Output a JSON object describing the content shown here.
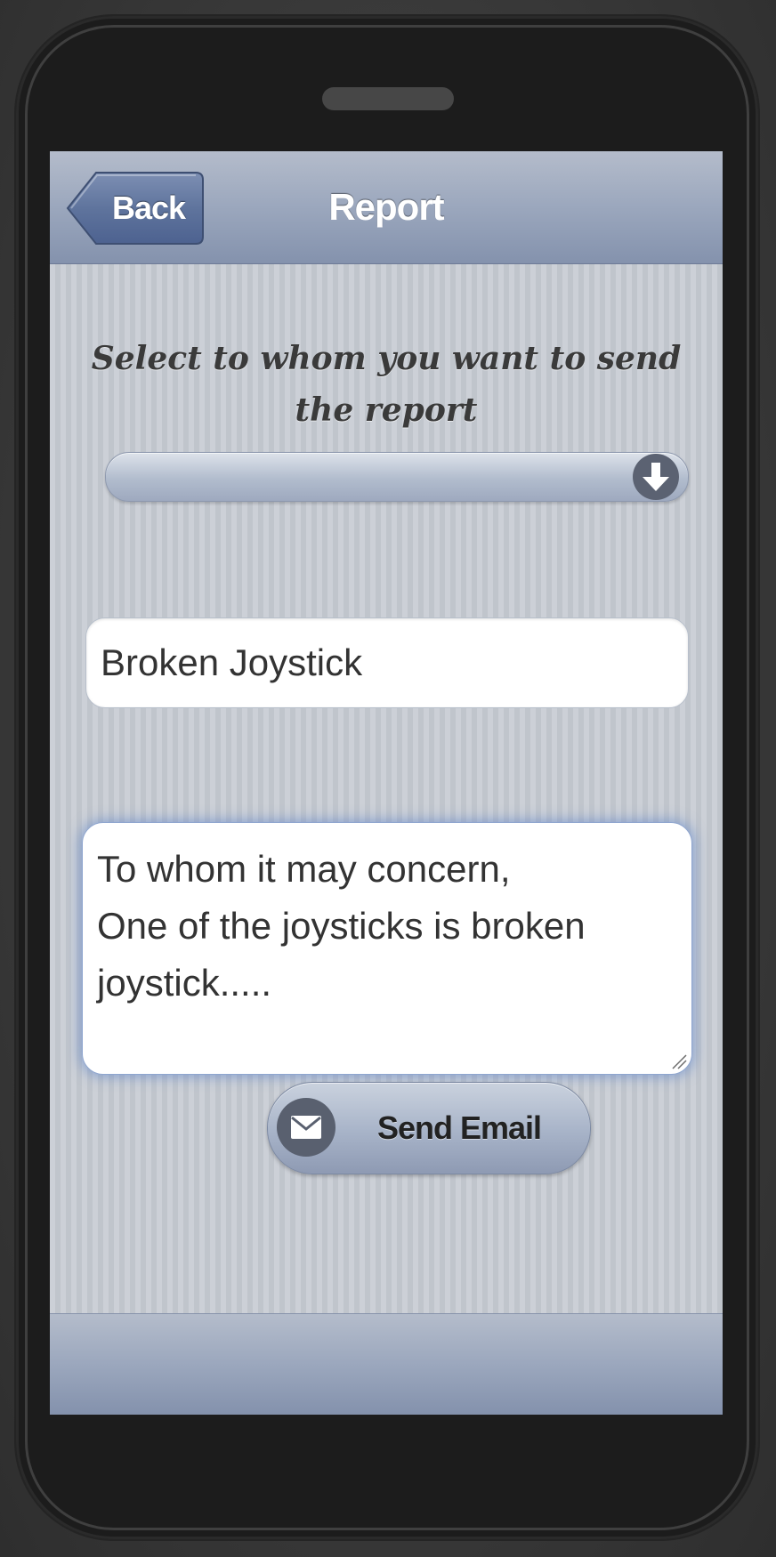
{
  "header": {
    "back_label": "Back",
    "title": "Report"
  },
  "form": {
    "prompt": "Select to whom you want to send the report",
    "recipient_select": {
      "selected": "",
      "icon": "arrow-down-circle-icon"
    },
    "subject_value": "Broken Joystick",
    "message_value": "To whom it may concern,\nOne of the joysticks is broken joystick.....",
    "send_label": "Send Email",
    "send_icon": "envelope-icon"
  },
  "colors": {
    "header_gradient_top": "#b4bccb",
    "header_gradient_bottom": "#8492ad",
    "screen_background": "#c6cbd3",
    "icon_circle": "#59606f",
    "textarea_focus_glow": "#5a82c8"
  }
}
